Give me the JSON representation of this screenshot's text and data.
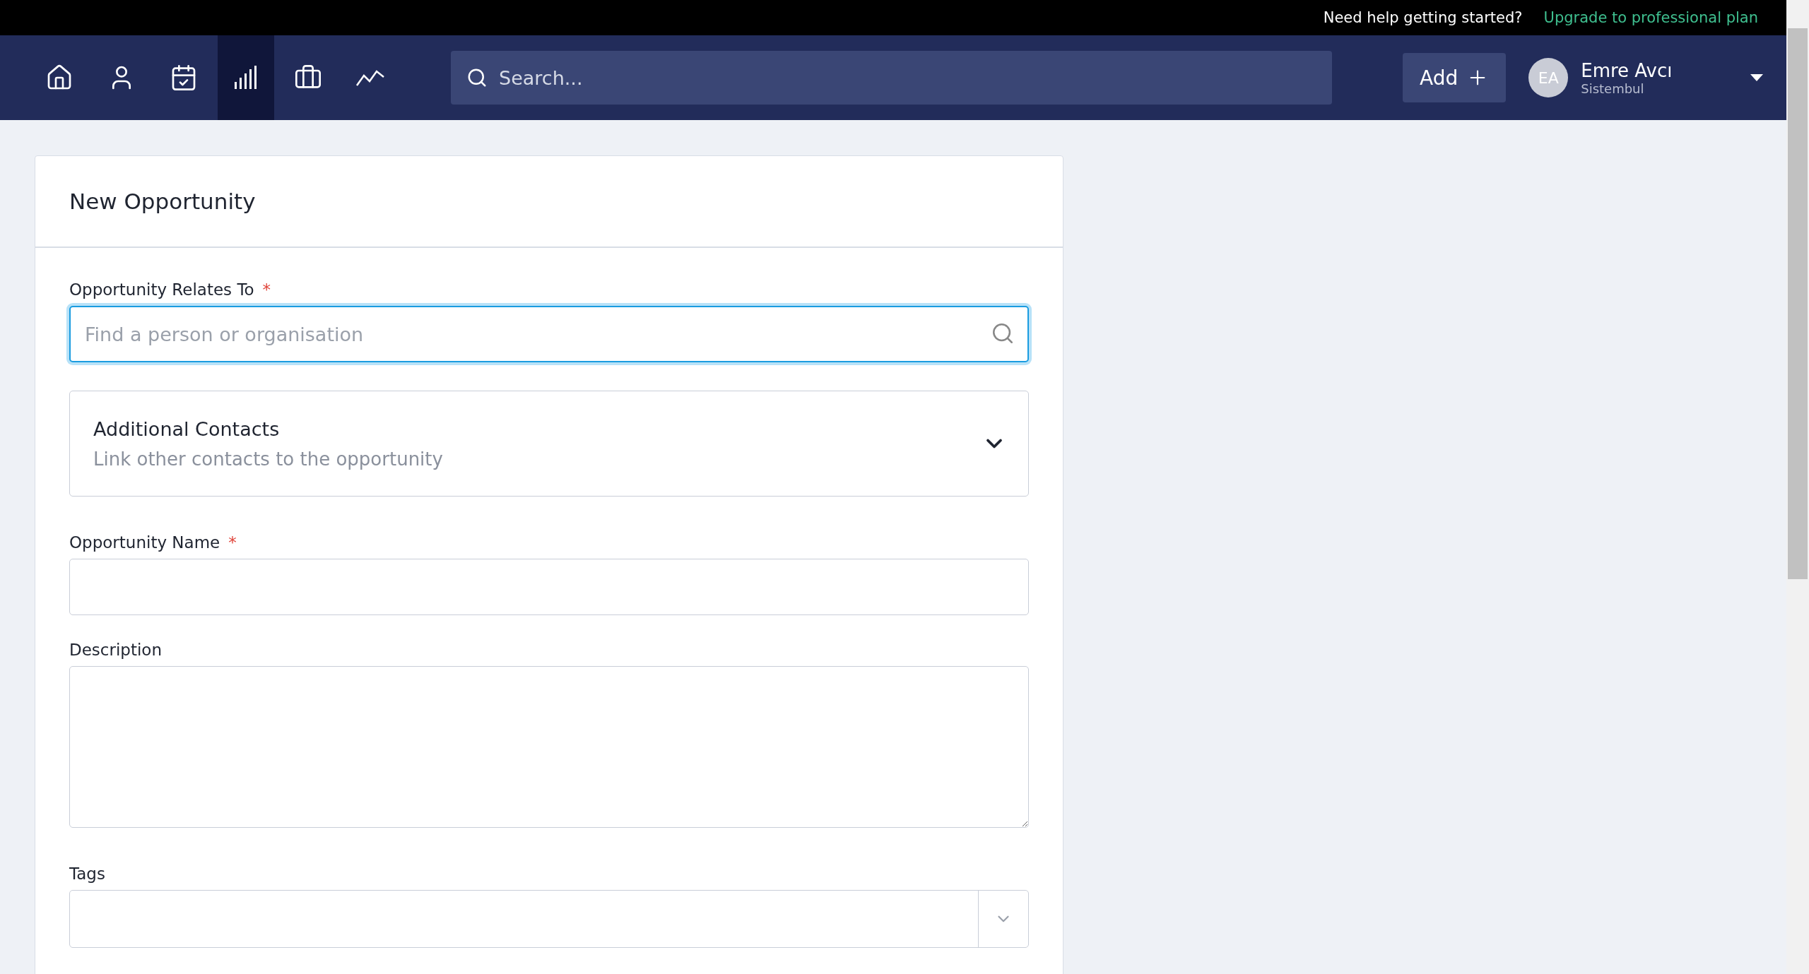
{
  "top_bar": {
    "help_text": "Need help getting started?",
    "upgrade_link": "Upgrade to professional plan"
  },
  "nav": {
    "items": [
      {
        "kind": "home",
        "selected": false
      },
      {
        "kind": "person",
        "selected": false
      },
      {
        "kind": "calendar",
        "selected": false
      },
      {
        "kind": "bars",
        "selected": true
      },
      {
        "kind": "briefcase",
        "selected": false
      },
      {
        "kind": "trend",
        "selected": false
      }
    ],
    "search": {
      "placeholder": "Search..."
    },
    "add_button": "Add",
    "user": {
      "initials": "EA",
      "name": "Emre Avcı",
      "company": "Sistembul"
    }
  },
  "form": {
    "title": "New Opportunity",
    "relates_to": {
      "label": "Opportunity Relates To",
      "required_mark": "*",
      "placeholder": "Find a person or organisation"
    },
    "additional_contacts": {
      "title": "Additional Contacts",
      "subtitle": "Link other contacts to the opportunity",
      "expanded": false
    },
    "name": {
      "label": "Opportunity Name",
      "required_mark": "*"
    },
    "description": {
      "label": "Description"
    },
    "tags": {
      "label": "Tags"
    }
  }
}
